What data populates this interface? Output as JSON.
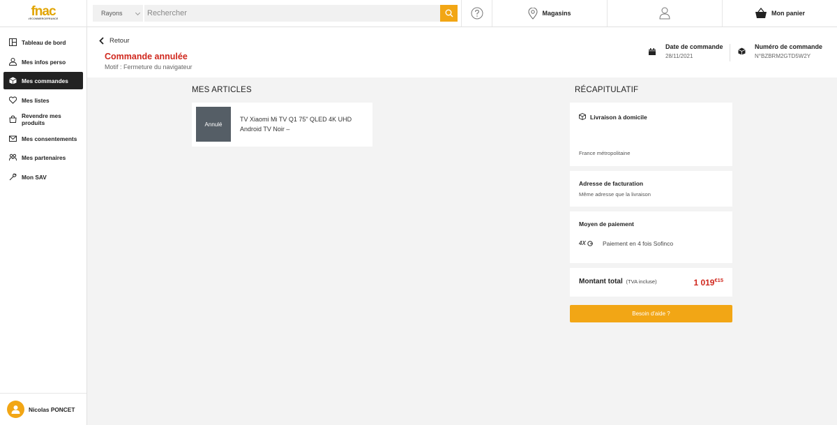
{
  "header": {
    "logo_main": "fnac",
    "logo_sub": "#ECOMMERCEFRANCE",
    "rayons_label": "Rayons",
    "search_placeholder": "Rechercher",
    "stores_label": "Magasins",
    "cart_label": "Mon panier"
  },
  "sidebar": {
    "items": [
      {
        "label": "Tableau de bord",
        "icon": "dashboard-icon"
      },
      {
        "label": "Mes infos perso",
        "icon": "user-icon"
      },
      {
        "label": "Mes commandes",
        "icon": "box-icon",
        "active": true
      },
      {
        "label": "Mes listes",
        "icon": "heart-icon"
      },
      {
        "label": "Revendre mes produits",
        "icon": "bag-icon"
      },
      {
        "label": "Mes consentements",
        "icon": "mail-icon"
      },
      {
        "label": "Mes partenaires",
        "icon": "partners-icon"
      },
      {
        "label": "Mon SAV",
        "icon": "wrench-icon"
      }
    ],
    "user_name": "Nicolas PONCET"
  },
  "order": {
    "back_label": "Retour",
    "status": "Commande annulée",
    "motif": "Motif : Fermeture du navigateur",
    "date_title": "Date de commande",
    "date_value": "28/11/2021",
    "number_title": "Numéro de commande",
    "number_value": "N°BZBRM2GTD5W2Y"
  },
  "articles": {
    "title": "MES ARTICLES",
    "items": [
      {
        "badge": "Annulé",
        "name": "TV Xiaomi Mi TV Q1 75\" QLED 4K UHD Android TV Noir –"
      }
    ]
  },
  "recap": {
    "title": "RÉCAPITULATIF",
    "delivery_title": "Livraison à domicile",
    "delivery_zone": "France métropolitaine",
    "billing_title": "Adresse de facturation",
    "billing_text": "Même adresse que la livraison",
    "payment_title": "Moyen de paiement",
    "payment_logo": "4X",
    "payment_text": "Paiement en 4 fois Sofinco",
    "total_label": "Montant total",
    "total_tax": "(TVA incluse)",
    "total_int": "1 019",
    "total_cents": "€15",
    "help_label": "Besoin d'aide ?"
  },
  "colors": {
    "accent": "#f2a615",
    "status_red": "#d0281e",
    "active_nav": "#222222"
  }
}
